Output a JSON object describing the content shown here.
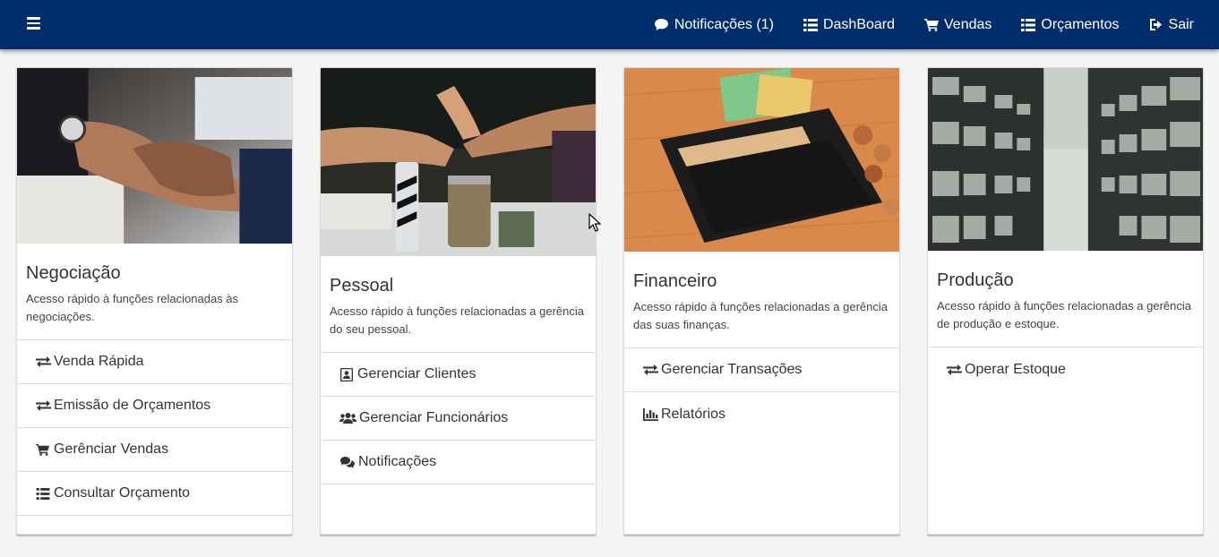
{
  "topbar": {
    "menu_icon": "hamburger-icon",
    "nav": [
      {
        "label": "Notificações (1)",
        "icon": "comment-icon"
      },
      {
        "label": "DashBoard",
        "icon": "list-icon"
      },
      {
        "label": "Vendas",
        "icon": "cart-icon"
      },
      {
        "label": "Orçamentos",
        "icon": "list-icon"
      },
      {
        "label": "Sair",
        "icon": "sign-out-icon"
      }
    ],
    "colors": {
      "background": "#002d6b",
      "text": "#ffffff"
    }
  },
  "cards": [
    {
      "title": "Negociação",
      "text": "Acesso rápido à funções relacionadas às negociações.",
      "image": "handshake-photo",
      "items": [
        {
          "label": "Venda Rápida",
          "icon": "exchange-icon"
        },
        {
          "label": "Emissão de Orçamentos",
          "icon": "exchange-icon"
        },
        {
          "label": "Gerênciar Vendas",
          "icon": "cart-icon"
        },
        {
          "label": "Consultar Orçamento",
          "icon": "list-icon"
        }
      ]
    },
    {
      "title": "Pessoal",
      "text": "Acesso rápido à funções relacionadas a gerência do seu pessoal.",
      "image": "team-fist-bump-photo",
      "items": [
        {
          "label": "Gerenciar Clientes",
          "icon": "address-book-icon"
        },
        {
          "label": "Gerenciar Funcionários",
          "icon": "users-icon"
        },
        {
          "label": "Notificações",
          "icon": "comments-icon"
        }
      ]
    },
    {
      "title": "Financeiro",
      "text": "Acesso rápido à funções relacionadas a gerência das suas finanças.",
      "image": "wallet-photo",
      "items": [
        {
          "label": "Gerenciar Transações",
          "icon": "exchange-icon"
        },
        {
          "label": "Relatórios",
          "icon": "bar-chart-icon"
        }
      ]
    },
    {
      "title": "Produção",
      "text": "Acesso rápido à funções relacionadas a gerência de produção e estoque.",
      "image": "warehouse-shelves-photo",
      "items": [
        {
          "label": "Operar Estoque",
          "icon": "exchange-icon"
        }
      ]
    }
  ]
}
